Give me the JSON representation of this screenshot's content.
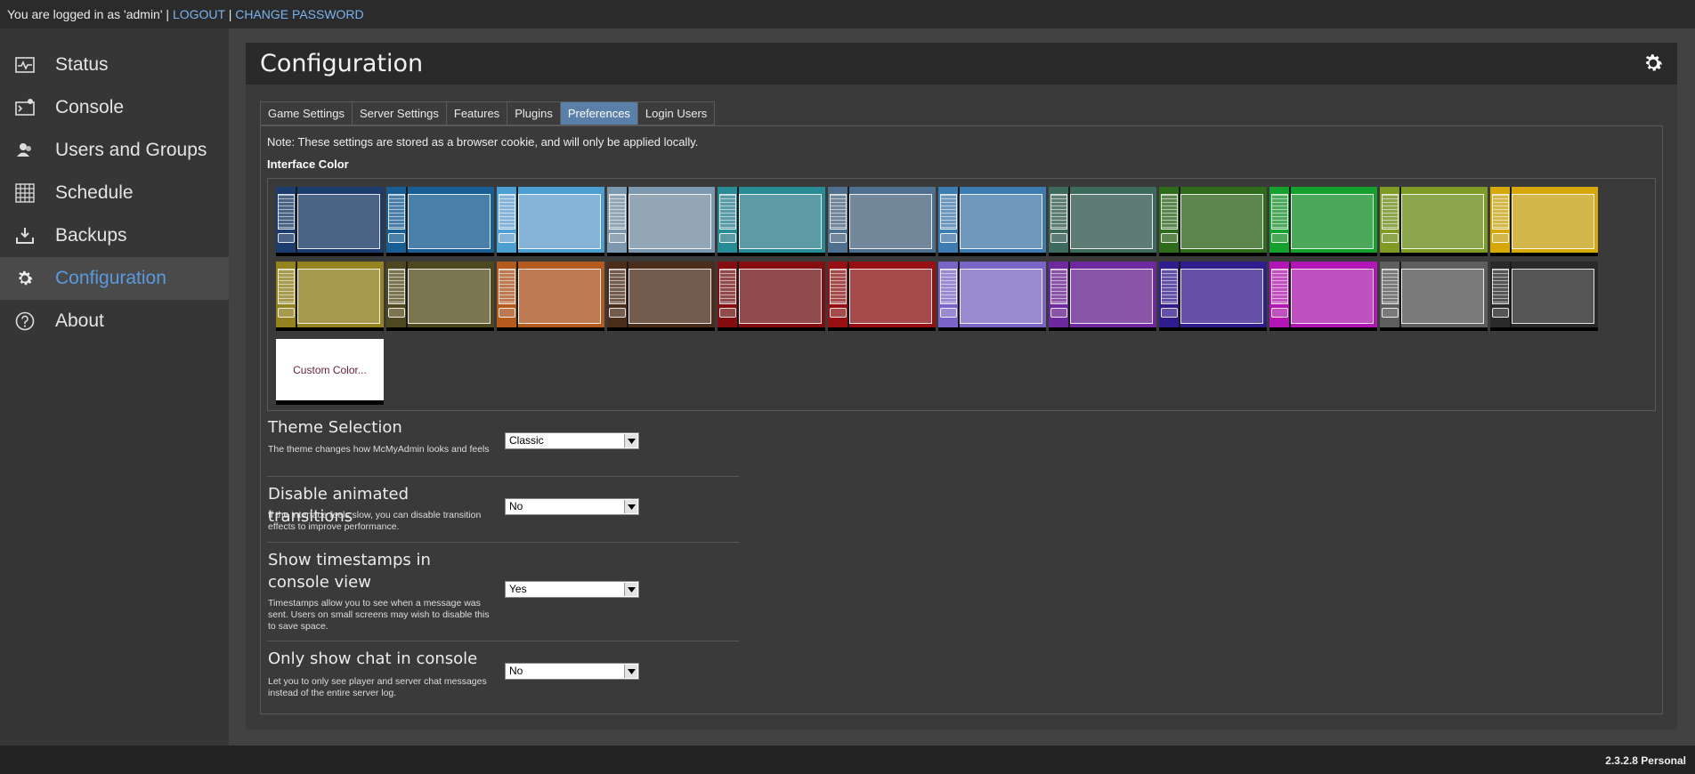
{
  "topbar": {
    "logged_in_text": "You are logged in as 'admin' |",
    "logout": "LOGOUT",
    "separator": "|",
    "change_password": "CHANGE PASSWORD"
  },
  "sidebar": {
    "items": [
      {
        "label": "Status",
        "icon": "status-icon",
        "active": false
      },
      {
        "label": "Console",
        "icon": "console-icon",
        "active": false
      },
      {
        "label": "Users and Groups",
        "icon": "users-icon",
        "active": false
      },
      {
        "label": "Schedule",
        "icon": "schedule-icon",
        "active": false
      },
      {
        "label": "Backups",
        "icon": "backups-icon",
        "active": false
      },
      {
        "label": "Configuration",
        "icon": "gear-icon",
        "active": true
      },
      {
        "label": "About",
        "icon": "help-icon",
        "active": false
      }
    ]
  },
  "panel": {
    "title": "Configuration"
  },
  "tabs": [
    {
      "label": "Game Settings",
      "active": false
    },
    {
      "label": "Server Settings",
      "active": false
    },
    {
      "label": "Features",
      "active": false
    },
    {
      "label": "Plugins",
      "active": false
    },
    {
      "label": "Preferences",
      "active": true
    },
    {
      "label": "Login Users",
      "active": false
    }
  ],
  "preferences": {
    "note": "Note: These settings are stored as a browser cookie, and will only be applied locally.",
    "interface_color_label": "Interface Color",
    "custom_color_label": "Custom Color...",
    "swatch_colors": [
      "#4b6486",
      "#4a7fa8",
      "#86b4d8",
      "#93a6b6",
      "#5c9aa6",
      "#73879b",
      "#7097bc",
      "#5f7c74",
      "#5d854e",
      "#4ca85a",
      "#8aa54c",
      "#d4b74a",
      "#a59a4e",
      "#7b764f",
      "#bc7952",
      "#735b4d",
      "#924b4c",
      "#a64b4c",
      "#9a8ad0",
      "#8a55a9",
      "#6450a6",
      "#c052c0",
      "#7a7a7a",
      "#555555"
    ],
    "swatch_edges": [
      "#1c3c6e",
      "#175e95",
      "#4c9fd3",
      "#7b98ae",
      "#288c97",
      "#4e6f8e",
      "#3d7cb0",
      "#3e6a5e",
      "#2e6b1b",
      "#16a02e",
      "#7f9b25",
      "#d6a80a",
      "#958320",
      "#4d4820",
      "#b45a1c",
      "#4a2e1b",
      "#850d10",
      "#980f13",
      "#7a64c8",
      "#6e28a0",
      "#2f1c8f",
      "#b216b5",
      "#5e5e5e",
      "#2a2a2a"
    ]
  },
  "settings": [
    {
      "title": "Theme Selection",
      "description": "The theme changes how McMyAdmin looks and feels",
      "value": "Classic"
    },
    {
      "title": "Disable animated transitions",
      "description": "If the interface feels slow, you can disable transition effects to improve performance.",
      "value": "No"
    },
    {
      "title": "Show timestamps in console view",
      "description": "Timestamps allow you to see when a message was sent. Users on small screens may wish to disable this to save space.",
      "value": "Yes"
    },
    {
      "title": "Only show chat in console",
      "description": "Let you to only see player and server chat messages instead of the entire server log.",
      "value": "No"
    }
  ],
  "footer": {
    "version": "2.3.2.8 Personal"
  }
}
